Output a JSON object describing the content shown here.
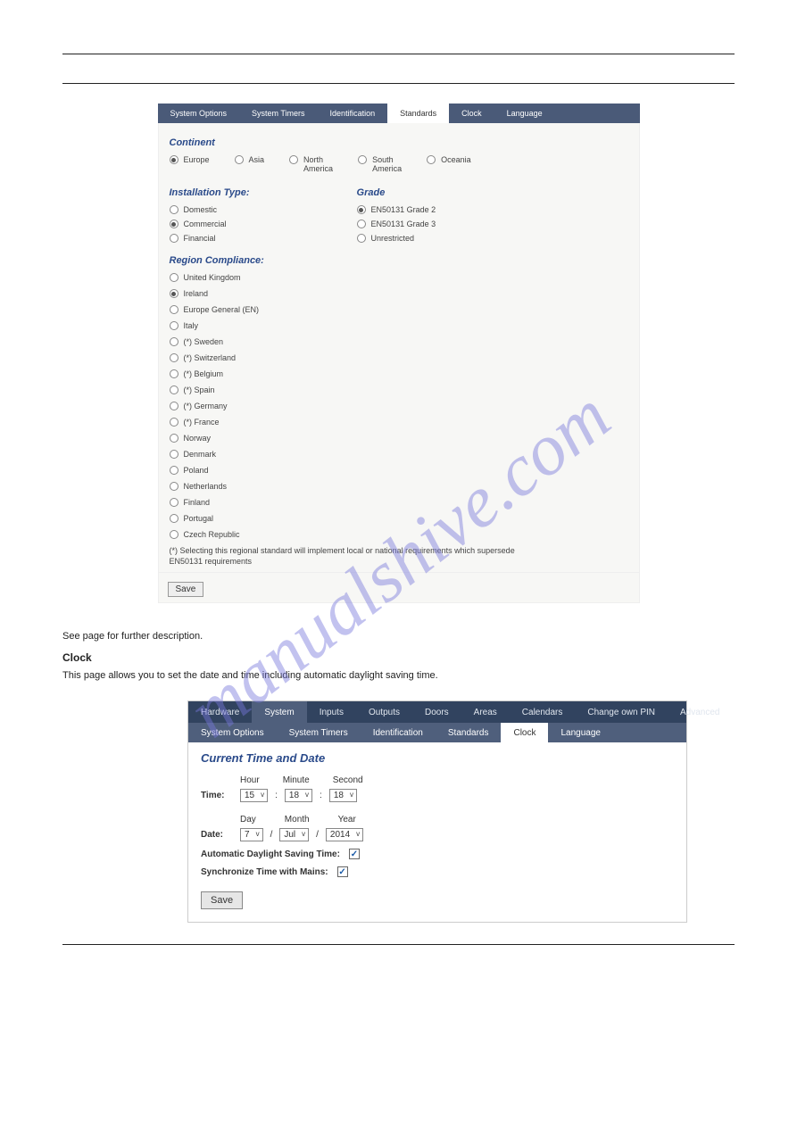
{
  "watermark": "manualshive.com",
  "panel1": {
    "tabs": [
      "System Options",
      "System Timers",
      "Identification",
      "Standards",
      "Clock",
      "Language"
    ],
    "activeTab": "Standards",
    "continent": {
      "title": "Continent",
      "items": [
        "Europe",
        "Asia",
        "North\nAmerica",
        "South\nAmerica",
        "Oceania"
      ],
      "selected": "Europe"
    },
    "installation": {
      "title": "Installation Type:",
      "items": [
        "Domestic",
        "Commercial",
        "Financial"
      ],
      "selected": "Commercial"
    },
    "grade": {
      "title": "Grade",
      "items": [
        "EN50131 Grade 2",
        "EN50131 Grade 3",
        "Unrestricted"
      ],
      "selected": "EN50131 Grade 2"
    },
    "region": {
      "title": "Region Compliance:",
      "items": [
        "United Kingdom",
        "Ireland",
        "Europe General (EN)",
        "Italy",
        "(*) Sweden",
        "(*) Switzerland",
        "(*) Belgium",
        "(*) Spain",
        "(*) Germany",
        "(*) France",
        "Norway",
        "Denmark",
        "Poland",
        "Netherlands",
        "Finland",
        "Portugal",
        "Czech Republic"
      ],
      "selected": "Ireland"
    },
    "footnote": "(*) Selecting this regional standard will implement local or national requirements which supersede EN50131 requirements",
    "saveLabel": "Save"
  },
  "midText": {
    "line1": "See page for further description.",
    "heading": "Clock",
    "line2": "This page allows you to set the date and time including automatic daylight saving time."
  },
  "panel2": {
    "mainTabs": [
      "Hardware",
      "System",
      "Inputs",
      "Outputs",
      "Doors",
      "Areas",
      "Calendars",
      "Change own PIN",
      "Advanced"
    ],
    "mainActive": "System",
    "subTabs": [
      "System Options",
      "System Timers",
      "Identification",
      "Standards",
      "Clock",
      "Language"
    ],
    "subActive": "Clock",
    "title": "Current Time and Date",
    "timeLabel": "Time:",
    "dateLabel": "Date:",
    "hourHead": "Hour",
    "minuteHead": "Minute",
    "secondHead": "Second",
    "dayHead": "Day",
    "monthHead": "Month",
    "yearHead": "Year",
    "hour": "15",
    "minute": "18",
    "second": "18",
    "day": "7",
    "month": "Jul",
    "year": "2014",
    "adst": "Automatic Daylight Saving Time:",
    "sync": "Synchronize Time with Mains:",
    "save": "Save"
  }
}
